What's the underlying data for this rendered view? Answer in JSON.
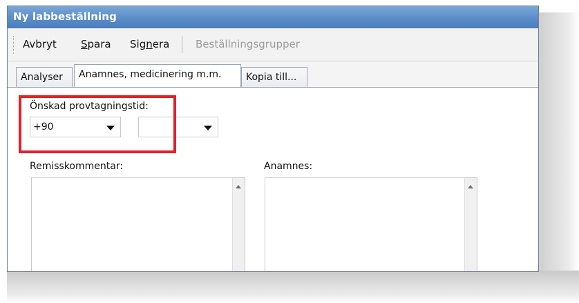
{
  "window": {
    "title": "Ny labbeställning"
  },
  "toolbar": {
    "cancel": {
      "pre": "Avbryt",
      "mn": "",
      "post": ""
    },
    "save": {
      "pre": "",
      "mn": "S",
      "post": "para"
    },
    "sign": {
      "pre": "Sig",
      "mn": "n",
      "post": "era"
    },
    "groups": "Beställningsgrupper"
  },
  "tabs": [
    {
      "label": "Analyser",
      "active": false
    },
    {
      "label": "Anamnes, medicinering m.m.",
      "active": true
    },
    {
      "label": "Kopia till...",
      "active": false
    }
  ],
  "form": {
    "sampling_time_label": "Önskad provtagningstid:",
    "sampling_time_value": "+90",
    "sampling_time_second_value": "",
    "remiss_label": "Remisskommentar:",
    "anamnes_label": "Anamnes:"
  },
  "colors": {
    "highlight": "#e41f2a",
    "titlebar": "#5a8cc8"
  },
  "icons": [
    "dropdown-arrow-icon",
    "scroll-up-icon"
  ]
}
